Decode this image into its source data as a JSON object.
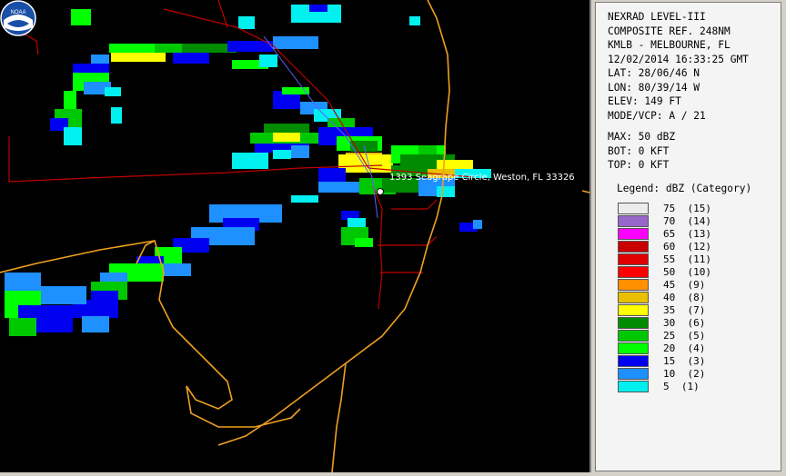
{
  "header": {
    "product": "NEXRAD LEVEL-III",
    "type": "COMPOSITE REF. 248NM",
    "station": "KMLB - MELBOURNE, FL",
    "datetime": "12/02/2014 16:33:25 GMT",
    "lat": "LAT: 28/06/46 N",
    "lon": "LON: 80/39/14 W",
    "elev": "ELEV: 149 FT",
    "mode": "MODE/VCP: A / 21"
  },
  "stats": {
    "max": "MAX: 50 dBZ",
    "bot": "BOT: 0 KFT",
    "top": "TOP: 0 KFT"
  },
  "legend": {
    "title": "Legend: dBZ (Category)",
    "items": [
      {
        "label": "75  (15)",
        "color": "#ececec"
      },
      {
        "label": "70  (14)",
        "color": "#9966cc"
      },
      {
        "label": "65  (13)",
        "color": "#ff00ff"
      },
      {
        "label": "60  (12)",
        "color": "#c80000"
      },
      {
        "label": "55  (11)",
        "color": "#e00000"
      },
      {
        "label": "50  (10)",
        "color": "#ff0000"
      },
      {
        "label": "45  (9)",
        "color": "#ff9000"
      },
      {
        "label": "40  (8)",
        "color": "#e8c000"
      },
      {
        "label": "35  (7)",
        "color": "#ffff00"
      },
      {
        "label": "30  (6)",
        "color": "#008c00"
      },
      {
        "label": "25  (5)",
        "color": "#00c800"
      },
      {
        "label": "20  (4)",
        "color": "#00ff00"
      },
      {
        "label": "15  (3)",
        "color": "#0000f0"
      },
      {
        "label": "10  (2)",
        "color": "#1e90ff"
      },
      {
        "label": "5  (1)",
        "color": "#00f0f0"
      }
    ]
  },
  "map": {
    "location_label": "1393 Seagrape Circle, Weston, FL 33326",
    "background": "#000000",
    "coast_color": "#f0a020",
    "county_color": "#c00000",
    "road_color": "#6060ff"
  },
  "logo": "noaa-logo"
}
